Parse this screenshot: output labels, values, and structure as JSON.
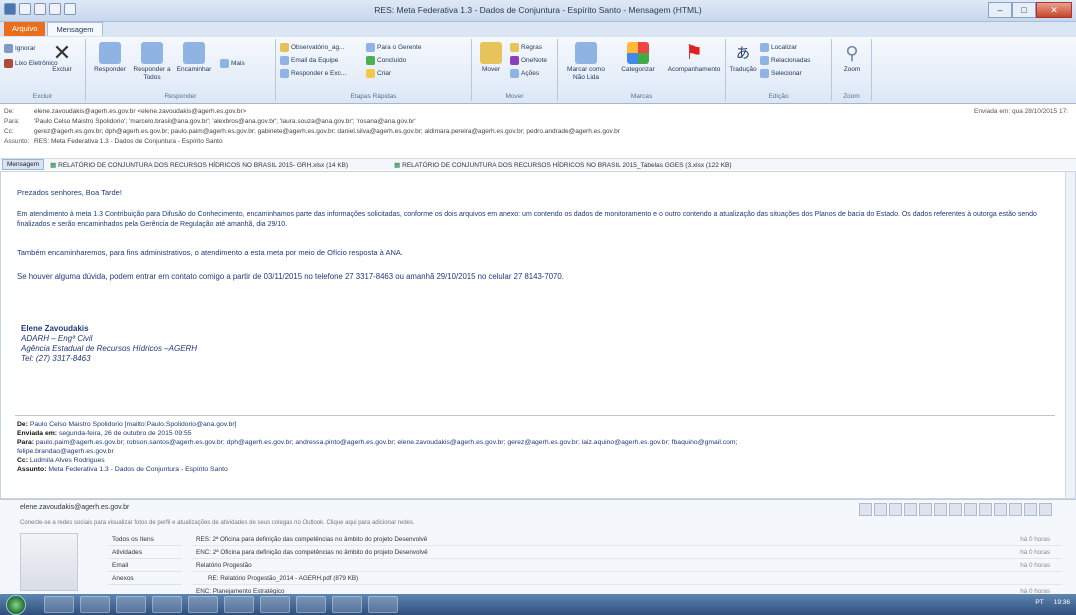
{
  "window": {
    "title": "RES: Meta Federativa 1.3 - Dados de Conjuntura - Espírito Santo - Mensagem (HTML)"
  },
  "ribbon": {
    "tabs": [
      "Arquivo",
      "Mensagem"
    ],
    "delete_group": {
      "label": "Excluir",
      "ignore": "Ignorar",
      "junk": "Lixo Eletrônico",
      "delete": "Excluir"
    },
    "respond_group": {
      "label": "Responder",
      "reply": "Responder",
      "reply_all": "Responder a Todos",
      "forward": "Encaminhar",
      "more": "Mais"
    },
    "quick_group": {
      "label": "Etapas Rápidas",
      "s1": "Observatório_ag...",
      "s2": "Para o Gerente",
      "s3": "Email da Equipe",
      "s4": "Concluído",
      "s5": "Responder e Exc...",
      "s6": "Criar"
    },
    "move_group": {
      "label": "Mover",
      "move": "Mover",
      "rules": "Regras",
      "onenote": "OneNote",
      "actions": "Ações"
    },
    "tags_group": {
      "label": "Marcas",
      "unread": "Marcar como Não Lida",
      "categorize": "Categorizar",
      "followup": "Acompanhamento"
    },
    "edit_group": {
      "label": "Edição",
      "translate": "Tradução",
      "find": "Localizar",
      "related": "Relacionadas",
      "select": "Selecionar"
    },
    "zoom_group": {
      "label": "Zoom",
      "zoom": "Zoom"
    }
  },
  "header": {
    "from_label": "De:",
    "from": "elene.zavoudakis@agerh.es.gov.br <elene.zavoudakis@agerh.es.gov.br>",
    "to_label": "Para:",
    "to": "'Paulo Celso Maistro Spolidorio'; 'marcelo.brasil@ana.gov.br'; 'alexbros@ana.gov.br'; 'laura.souza@ana.gov.br'; 'rosana@ana.gov.br'",
    "cc_label": "Cc:",
    "cc": "gerez@agerh.es.gov.br; dph@agerh.es.gov.br; paulo.paim@agerh.es.gov.br; gabinete@agerh.es.gov.br; daniel.silva@agerh.es.gov.br; aldimara.pereira@agerh.es.gov.br; pedro.andrade@agerh.es.gov.br",
    "subject_label": "Assunto:",
    "subject": "RES: Meta Federativa 1.3 - Dados de Conjuntura - Espírito Santo",
    "sent": "Enviada em: qua 28/10/2015 17:"
  },
  "attachments": {
    "message_tab": "Mensagem",
    "a1": "RELATÓRIO DE CONJUNTURA DOS RECURSOS HÍDRICOS NO BRASIL 2015- GRH.xlsx (14 KB)",
    "a2": "RELATÓRIO DE CONJUNTURA DOS RECURSOS HÍDRICOS NO BRASIL 2015_Tabelas GGES (3.xlsx (122 KB)"
  },
  "body": {
    "greeting": "Prezados senhores, Boa Tarde!",
    "para1": "Em atendimento à meta 1.3 Contribuição para Difusão do Conhecimento, encaminhamos parte das informações solicitadas, conforme os dois arquivos em anexo: um contendo os dados de monitoramento e o outro contendo a atualização das situações dos Planos de bacia do Estado. Os dados referentes à outorga estão sendo finalizados e serão encaminhados pela Gerência de Regulação até amanhã, dia 29/10.",
    "para2": "Também encaminharemos, para fins administrativos, o atendimento a esta meta por meio de Ofício resposta à ANA.",
    "para3": "Se houver alguma dúvida, podem entrar em contato comigo a partir de 03/11/2015 no telefone 27 3317-8463 ou amanhã 29/10/2015 no celular 27 8143-7070.",
    "sig_name": "Elene Zavoudakis",
    "sig_role": "ADARH – Engª Civil",
    "sig_org": "Agência Estadual de Recursos Hídricos –AGERH",
    "sig_tel": "Tel: (27) 3317-8463",
    "fw_from_label": "De:",
    "fw_from": "Paulo Celso Maistro Spolidorio [mailto:Paulo.Spolidorio@ana.gov.br]",
    "fw_sent_label": "Enviada em:",
    "fw_sent": "segunda-feira, 26 de outubro de 2015 09:55",
    "fw_to_label": "Para:",
    "fw_to": "paulo.paim@agerh.es.gov.br; robson.santos@agerh.es.gov.br; dph@agerh.es.gov.br; andressa.pinto@agerh.es.gov.br; elene.zavoudakis@agerh.es.gov.br; gerez@agerh.es.gov.br; laiz.aquino@agerh.es.gov.br; fbaquino@gmail.com;",
    "fw_to2": "felipe.brandao@agerh.es.gov.br",
    "fw_cc_label": "Cc:",
    "fw_cc": "Ludmila Alves Rodrigues",
    "fw_subject_label": "Assunto:",
    "fw_subject": "Meta Federativa 1.3 - Dados de Conjuntura - Espírito Santo"
  },
  "people": {
    "name": "elene.zavoudakis@agerh.es.gov.br",
    "note": "Conecte-se a redes sociais para visualizar fotos de perfil e atualizações de atividades de seus colegas no Outlook. Clique aqui para adicionar redes.",
    "nav": [
      "Todos os Itens",
      "Atividades",
      "Email",
      "Anexos"
    ],
    "items": [
      {
        "text": "RES: 2ª Oficina para definição das competências no âmbito do projeto Desenvolvê",
        "time": "há 0 horas"
      },
      {
        "text": "ENC: 2ª Oficina para definição das competências no âmbito do projeto Desenvolvê",
        "time": "há 0 horas"
      },
      {
        "text": "Relatório Progestão",
        "time": "há 0 horas"
      },
      {
        "text": "RE: Relatório Progestão_2014 - AGERH.pdf (879 KB)",
        "time": ""
      },
      {
        "text": "ENC: Planejamento Estratégico",
        "time": "há 0 horas"
      }
    ]
  },
  "taskbar": {
    "lang": "PT",
    "time": "19:36"
  }
}
